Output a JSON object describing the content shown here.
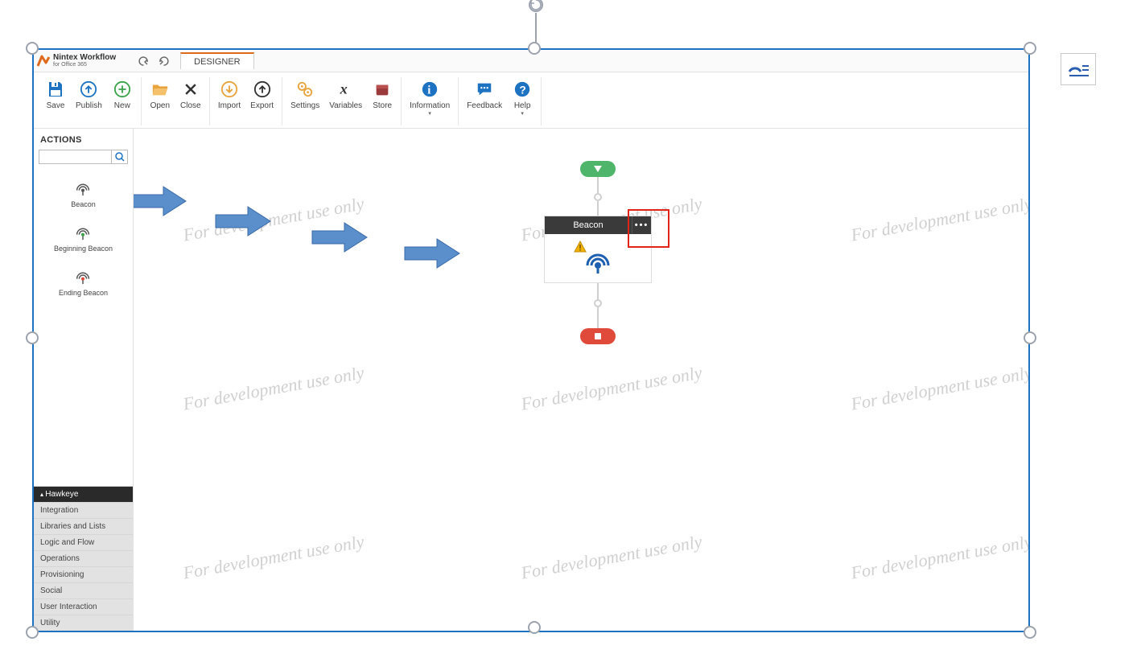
{
  "app": {
    "name_line1": "Nintex Workflow",
    "name_line2": "for Office 365",
    "tab_label": "DESIGNER"
  },
  "ribbon": {
    "save": "Save",
    "publish": "Publish",
    "new": "New",
    "open": "Open",
    "close": "Close",
    "import": "Import",
    "export": "Export",
    "settings": "Settings",
    "variables": "Variables",
    "store": "Store",
    "information": "Information",
    "feedback": "Feedback",
    "help": "Help"
  },
  "sidebar": {
    "heading": "ACTIONS",
    "search_placeholder": "",
    "items": [
      {
        "label": "Beacon",
        "icon": "beacon"
      },
      {
        "label": "Beginning Beacon",
        "icon": "beacon-begin"
      },
      {
        "label": "Ending Beacon",
        "icon": "beacon-end"
      }
    ],
    "categories": [
      {
        "label": "Hawkeye",
        "active": true
      },
      {
        "label": "Integration",
        "active": false
      },
      {
        "label": "Libraries and Lists",
        "active": false
      },
      {
        "label": "Logic and Flow",
        "active": false
      },
      {
        "label": "Operations",
        "active": false
      },
      {
        "label": "Provisioning",
        "active": false
      },
      {
        "label": "Social",
        "active": false
      },
      {
        "label": "User Interaction",
        "active": false
      },
      {
        "label": "Utility",
        "active": false
      }
    ]
  },
  "canvas": {
    "watermark_text": "For development use only",
    "node_title": "Beacon",
    "node_menu_glyph": "•••"
  }
}
